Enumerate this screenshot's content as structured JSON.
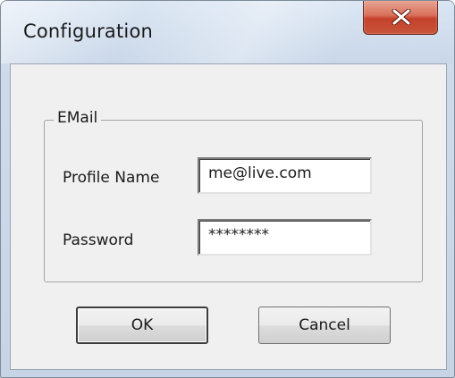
{
  "dialog": {
    "title": "Configuration",
    "close_label": "X"
  },
  "email_group": {
    "legend": "EMail",
    "profile_name": {
      "label": "Profile Name",
      "value": "me@live.com"
    },
    "password": {
      "label": "Password",
      "value": "********"
    }
  },
  "buttons": {
    "ok_label": "OK",
    "cancel_label": "Cancel"
  }
}
